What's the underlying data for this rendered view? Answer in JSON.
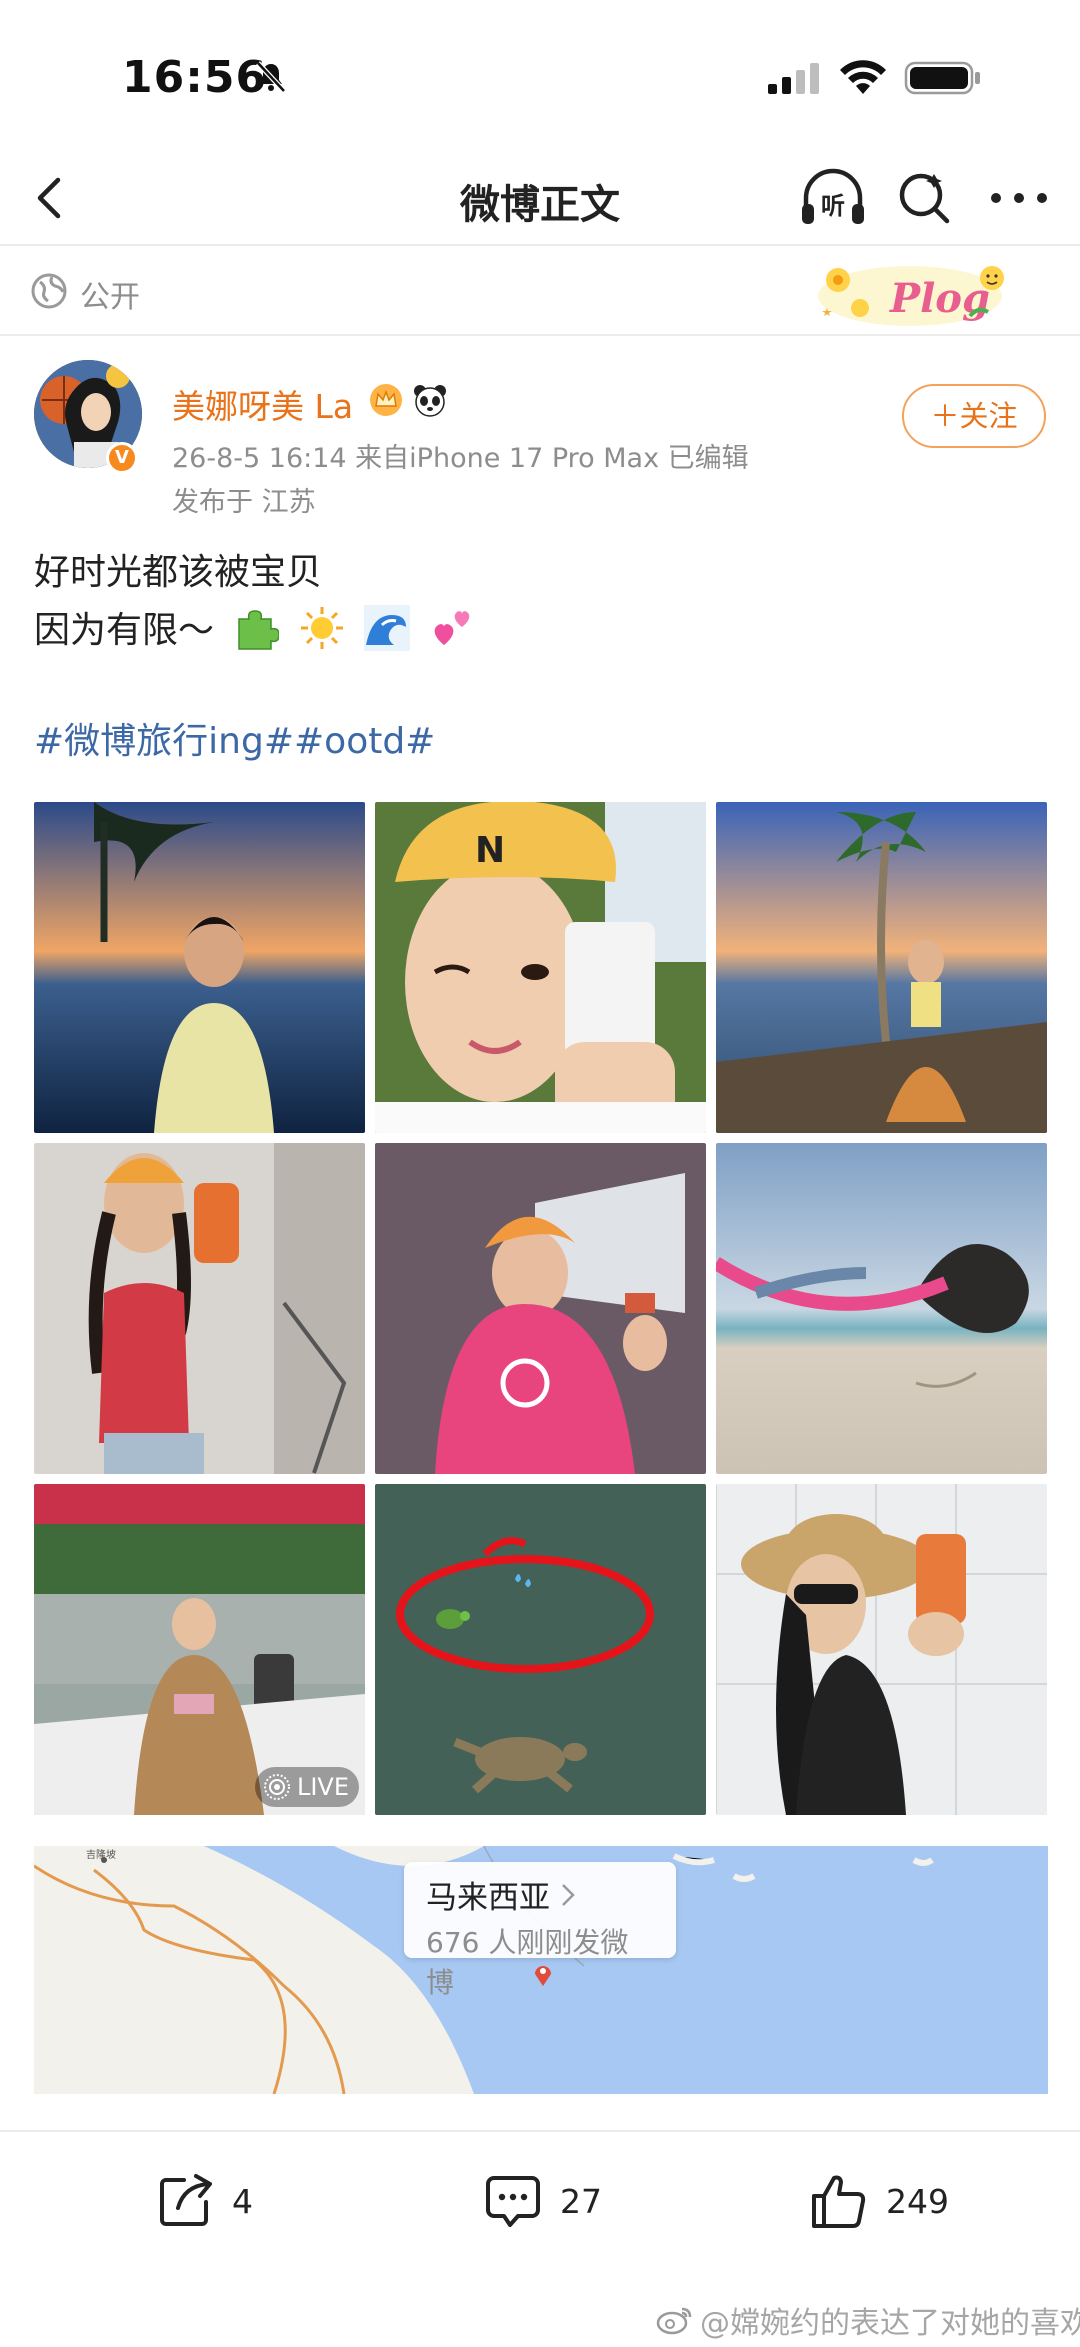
{
  "status_bar": {
    "time": "16:56"
  },
  "nav": {
    "title": "微博正文"
  },
  "visibility": {
    "label": "公开"
  },
  "author": {
    "name": "美娜呀美 La",
    "verified": "V"
  },
  "post": {
    "meta": "26-8-5 16:14  来自iPhone 17 Pro Max  已编辑",
    "location": "发布于 江苏",
    "line1": "好时光都该被宝贝",
    "line2": "因为有限～",
    "hashtags": "#微博旅行ing##ootd#",
    "emojis": [
      "puzzle-icon",
      "sun-icon",
      "wave-icon",
      "hearts-icon"
    ]
  },
  "follow_button": {
    "label": "＋关注"
  },
  "photos": [
    {
      "name": "photo-sunset-palm-girl"
    },
    {
      "name": "photo-selfie-yellow-cap",
      "cap_letter": "N"
    },
    {
      "name": "photo-pier-palm-skirt"
    },
    {
      "name": "photo-red-swimsuit-mirror"
    },
    {
      "name": "photo-pink-lifejacket"
    },
    {
      "name": "photo-hammock-beach"
    },
    {
      "name": "photo-boat-ride",
      "badge": "LIVE"
    },
    {
      "name": "photo-sea-turtle"
    },
    {
      "name": "photo-straw-hat-mirror"
    }
  ],
  "map": {
    "place": "马来西亚",
    "count_text": "676 人刚刚发微博",
    "city_label": "吉隆坡"
  },
  "actions": {
    "repost_count": "4",
    "comment_count": "27",
    "like_count": "249"
  },
  "watermark": {
    "text": "@嫦婉约的表达了对她的喜欢"
  },
  "colors": {
    "orange": "#e8731a",
    "link_blue": "#3c68a6",
    "map_sea": "#a7c8f2"
  }
}
